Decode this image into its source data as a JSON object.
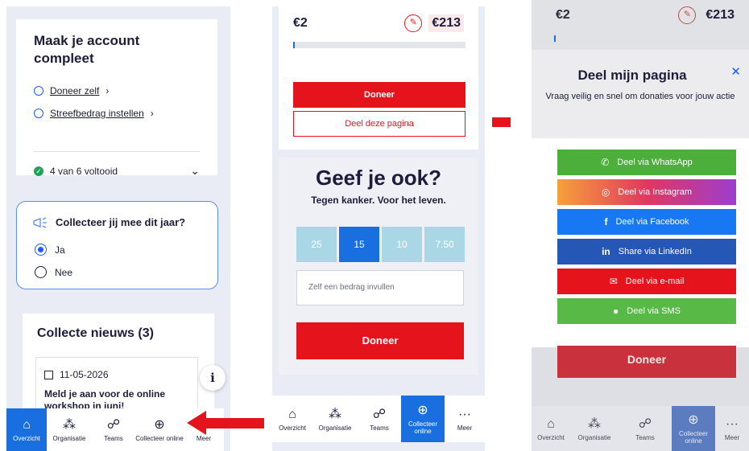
{
  "panel1": {
    "account_title": "Maak je account compleet",
    "tasks": [
      {
        "label": "Doneer zelf"
      },
      {
        "label": "Streefbedrag instellen"
      }
    ],
    "progress_text": "4 van 6 voltooid",
    "question": "Collecteer jij mee dit jaar?",
    "options": [
      "Ja",
      "Nee"
    ],
    "selected_option": "Ja",
    "news_title": "Collecte nieuws (3)",
    "news_date": "11-05-2026",
    "news_headline": "Meld je aan voor de online workshop in juni!",
    "nav": [
      {
        "label": "Overzicht",
        "icon": "home-icon",
        "active": true
      },
      {
        "label": "Organisatie",
        "icon": "organization-icon",
        "active": false
      },
      {
        "label": "Teams",
        "icon": "teams-icon",
        "active": false
      },
      {
        "label": "Collecteer online",
        "icon": "globe-icon",
        "active": false
      },
      {
        "label": "Meer",
        "icon": "more-icon",
        "active": false
      }
    ]
  },
  "panel2": {
    "amount_raised": "€2",
    "goal": "€213",
    "progress_fraction": 0.01,
    "donate_label": "Doneer",
    "share_label": "Deel deze pagina",
    "give_title": "Geef je ook?",
    "give_subtitle": "Tegen kanker. Voor het leven.",
    "amount_options": [
      "25",
      "15",
      "10",
      "7.50"
    ],
    "selected_amount": "15",
    "custom_amount_placeholder": "Zelf een bedrag invullen",
    "donate_button": "Doneer",
    "nav": [
      {
        "label": "Overzicht",
        "icon": "home-icon"
      },
      {
        "label": "Organisatie",
        "icon": "organization-icon"
      },
      {
        "label": "Teams",
        "icon": "teams-icon"
      },
      {
        "label": "Collecteer online",
        "icon": "globe-icon",
        "active": true
      },
      {
        "label": "Meer",
        "icon": "more-icon"
      }
    ]
  },
  "panel3": {
    "amount_raised": "€2",
    "goal": "€213",
    "sheet_title": "Deel mijn pagina",
    "close_icon": "close-icon",
    "sheet_description": "Vraag veilig en snel om donaties voor jouw actie",
    "share_options": [
      {
        "label": "Deel via WhatsApp",
        "icon": "whatsapp-icon",
        "color": "#4caf3c"
      },
      {
        "label": "Deel via Instagram",
        "icon": "instagram-icon",
        "color": "#c13584"
      },
      {
        "label": "Deel via Facebook",
        "icon": "facebook-icon",
        "color": "#1877f2"
      },
      {
        "label": "Share via LinkedIn",
        "icon": "linkedin-icon",
        "color": "#2557b7"
      },
      {
        "label": "Deel via e-mail",
        "icon": "mail-icon",
        "color": "#e5141c"
      },
      {
        "label": "Deel via SMS",
        "icon": "sms-icon",
        "color": "#58b947"
      }
    ],
    "donate_label": "Doneer",
    "nav": [
      {
        "label": "Overzicht",
        "icon": "home-icon"
      },
      {
        "label": "Organisatie",
        "icon": "organization-icon"
      },
      {
        "label": "Teams",
        "icon": "teams-icon"
      },
      {
        "label": "Collecteer online",
        "icon": "globe-icon",
        "active": true
      },
      {
        "label": "Meer",
        "icon": "more-icon"
      }
    ]
  },
  "colors": {
    "brand_red": "#e5141c",
    "brand_blue": "#1a6fe0"
  }
}
